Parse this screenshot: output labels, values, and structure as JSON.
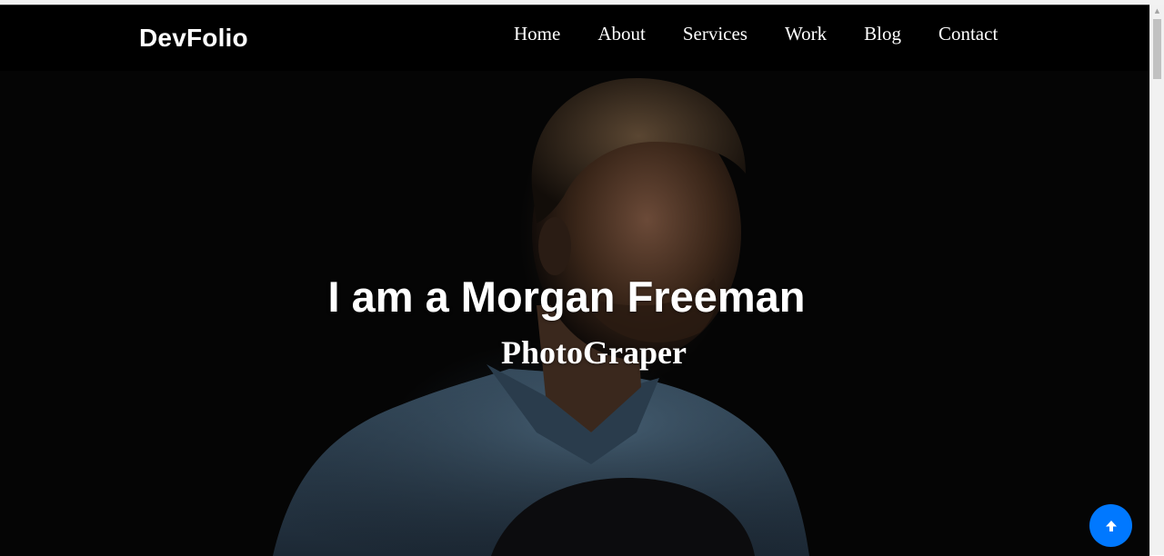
{
  "brand": "DevFolio",
  "nav": {
    "items": [
      {
        "label": "Home"
      },
      {
        "label": "About"
      },
      {
        "label": "Services"
      },
      {
        "label": "Work"
      },
      {
        "label": "Blog"
      },
      {
        "label": "Contact"
      }
    ]
  },
  "hero": {
    "title": "I am a Morgan Freeman",
    "subtitle": "PhotoGraper"
  },
  "back_to_top": {
    "icon": "arrow-up-icon",
    "color": "#0078ff"
  },
  "colors": {
    "navbar": "#000000",
    "text": "#ffffff",
    "accent": "#0078ff"
  }
}
